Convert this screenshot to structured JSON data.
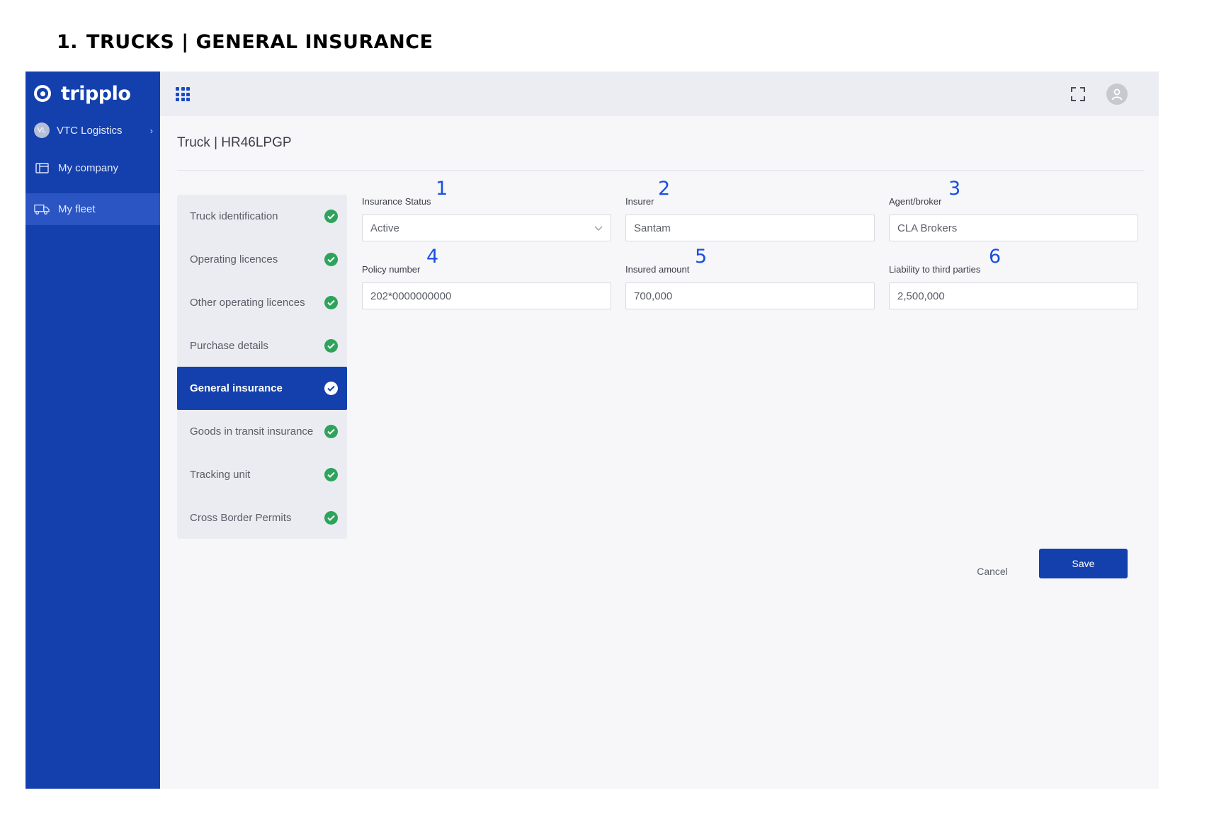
{
  "doc": {
    "number": "1.",
    "heading": "TRUCKS | GENERAL INSURANCE"
  },
  "sidebar": {
    "brand": "tripplo",
    "org": {
      "initials": "VL",
      "name": "VTC Logistics",
      "chevron": "›"
    },
    "items": [
      {
        "label": "My company",
        "icon": "building-icon"
      },
      {
        "label": "My fleet",
        "icon": "truck-icon",
        "active": true
      }
    ]
  },
  "topbar": {
    "icons": [
      "apps-grid-icon",
      "fullscreen-icon",
      "user-avatar-icon"
    ]
  },
  "page": {
    "title": "Truck | HR46LPGP"
  },
  "steps": [
    {
      "label": "Truck identification",
      "done": true
    },
    {
      "label": "Operating licences",
      "done": true
    },
    {
      "label": "Other operating licences",
      "done": true
    },
    {
      "label": "Purchase details",
      "done": true
    },
    {
      "label": "General insurance",
      "done": true,
      "active": true
    },
    {
      "label": "Goods in transit insurance",
      "done": true
    },
    {
      "label": "Tracking unit",
      "done": true
    },
    {
      "label": "Cross Border Permits",
      "done": true
    }
  ],
  "form": {
    "insurance_status": {
      "label": "Insurance Status",
      "value": "Active",
      "marker": "1"
    },
    "insurer": {
      "label": "Insurer",
      "value": "Santam",
      "marker": "2"
    },
    "agent_broker": {
      "label": "Agent/broker",
      "value": "CLA Brokers",
      "marker": "3"
    },
    "policy_number": {
      "label": "Policy number",
      "value": "202*0000000000",
      "marker": "4"
    },
    "insured_amount": {
      "label": "Insured amount",
      "value": "700,000",
      "marker": "5"
    },
    "liability": {
      "label": "Liability to third parties",
      "value": "2,500,000",
      "marker": "6"
    }
  },
  "actions": {
    "cancel": "Cancel",
    "save": "Save"
  },
  "colors": {
    "primary": "#1440ae",
    "success": "#2ea35b",
    "marker": "#1a4fe0"
  }
}
